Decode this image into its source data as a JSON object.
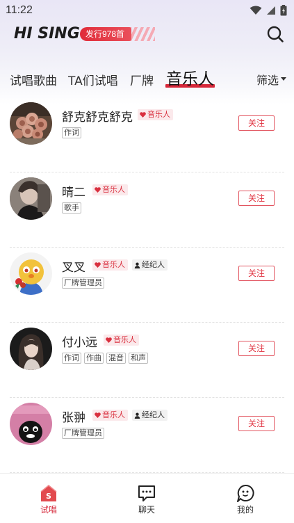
{
  "status_bar": {
    "time": "11:22"
  },
  "header": {
    "logo": "HI SING",
    "release_badge": "发行978首"
  },
  "tabs": [
    {
      "label": "试唱歌曲",
      "active": false
    },
    {
      "label": "TA们试唱",
      "active": false
    },
    {
      "label": "厂牌",
      "active": false
    },
    {
      "label": "音乐人",
      "active": true
    }
  ],
  "filter_label": "筛选",
  "users": [
    {
      "name": "舒克舒克舒克",
      "badges": [
        "音乐人"
      ],
      "roles": [
        "作词"
      ],
      "follow": "关注",
      "avatar": "flowers-photo"
    },
    {
      "name": "晴二",
      "badges": [
        "音乐人"
      ],
      "roles": [
        "歌手"
      ],
      "follow": "关注",
      "avatar": "girl-photo"
    },
    {
      "name": "叉叉",
      "badges": [
        "音乐人",
        "经纪人"
      ],
      "roles": [
        "厂牌管理员"
      ],
      "follow": "关注",
      "avatar": "cartoon-yellow"
    },
    {
      "name": "付小远",
      "badges": [
        "音乐人"
      ],
      "roles": [
        "作词",
        "作曲",
        "混音",
        "和声"
      ],
      "follow": "关注",
      "avatar": "woman-photo"
    },
    {
      "name": "张翀",
      "badges": [
        "音乐人",
        "经纪人"
      ],
      "roles": [
        "厂牌管理员"
      ],
      "follow": "关注",
      "avatar": "penguin-pink"
    }
  ],
  "bottom_nav": [
    {
      "label": "试唱",
      "active": true,
      "icon": "home-s-icon"
    },
    {
      "label": "聊天",
      "active": false,
      "icon": "chat-icon"
    },
    {
      "label": "我的",
      "active": false,
      "icon": "profile-face-icon"
    }
  ],
  "colors": {
    "accent": "#d6283a",
    "musician_tag_bg": "#fbe9eb"
  }
}
